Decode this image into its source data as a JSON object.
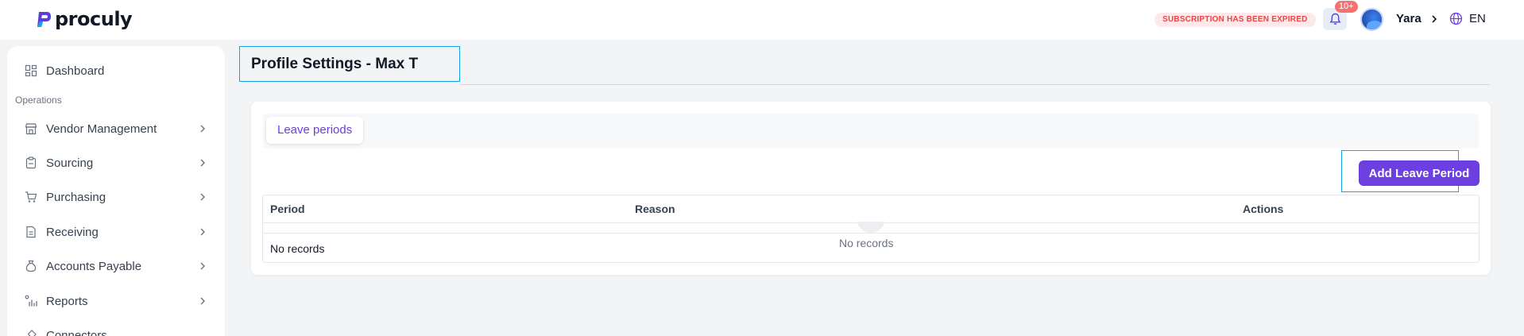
{
  "brand": {
    "name": "proculy"
  },
  "topbar": {
    "subscription_notice": "SUBSCRIPTION HAS BEEN EXPIRED",
    "notifications_count": "10+",
    "user_name": "Yara",
    "language": "EN"
  },
  "sidebar": {
    "section_operations": "Operations",
    "items": [
      {
        "label": "Dashboard",
        "icon": "dashboard-icon"
      },
      {
        "label": "Vendor Management",
        "icon": "store-icon"
      },
      {
        "label": "Sourcing",
        "icon": "clipboard-icon"
      },
      {
        "label": "Purchasing",
        "icon": "cart-icon"
      },
      {
        "label": "Receiving",
        "icon": "document-icon"
      },
      {
        "label": "Accounts Payable",
        "icon": "money-bag-icon"
      },
      {
        "label": "Reports",
        "icon": "bar-chart-icon"
      },
      {
        "label": "Connectors",
        "icon": "plug-icon"
      }
    ]
  },
  "page": {
    "title": "Profile Settings - Max T",
    "tabs": [
      {
        "label": "Leave periods",
        "active": true
      }
    ],
    "add_button_label": "Add Leave Period",
    "table": {
      "columns": [
        "Period",
        "Reason",
        "Actions"
      ],
      "empty_state": "No records",
      "row_text": "No records"
    }
  },
  "colors": {
    "accent": "#6d3fe0",
    "danger": "#ef4444",
    "focus_outline": "#0ea5e9"
  }
}
